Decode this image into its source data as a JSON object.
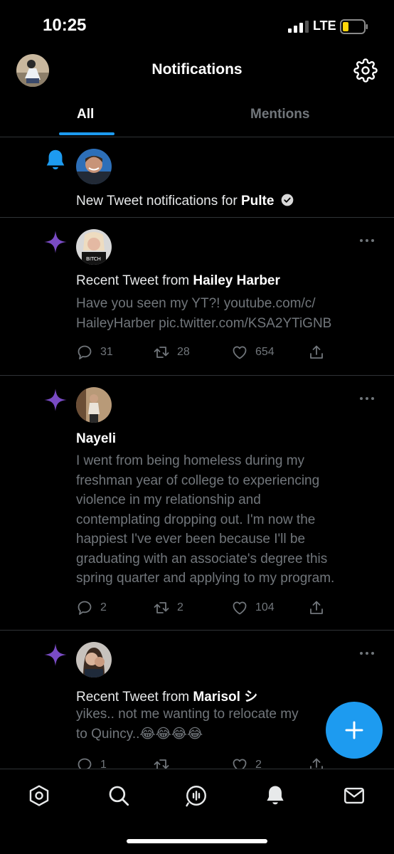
{
  "status_bar": {
    "time": "10:25",
    "network": "LTE"
  },
  "header": {
    "title": "Notifications"
  },
  "tabs": [
    {
      "label": "All"
    },
    {
      "label": "Mentions"
    }
  ],
  "notifications": [
    {
      "type": "new-tweet-notifications",
      "icon": "bell-icon",
      "text_prefix": "New Tweet notifications for ",
      "name": "Pulte",
      "verified": true
    },
    {
      "type": "recent-tweet",
      "icon": "sparkle-icon",
      "text_prefix": "Recent Tweet from ",
      "name": "Hailey Harber",
      "body_lines": [
        "Have you seen my YT?!  youtube.com/c/",
        "HaileyHarber pic.twitter.com/KSA2YTiGNB"
      ],
      "replies": "31",
      "retweets": "28",
      "likes": "654"
    },
    {
      "type": "recommended-tweet",
      "icon": "sparkle-icon",
      "name": "Nayeli",
      "body_lines": [
        "I went from being homeless during my",
        "freshman year of college to experiencing",
        "violence in my relationship and",
        "contemplating dropping out. I'm now the",
        "happiest I've ever been because I'll be",
        "graduating with an associate's degree this",
        "spring quarter and applying to my program."
      ],
      "replies": "2",
      "retweets": "2",
      "likes": "104"
    },
    {
      "type": "recent-tweet",
      "icon": "sparkle-icon",
      "text_prefix": "Recent Tweet from ",
      "name": "Marisol シ",
      "body_lines": [
        "yikes.. not me wanting to relocate my",
        "to Quincy..😂😂😂😂"
      ],
      "replies": "1",
      "retweets": "",
      "likes": "2"
    }
  ],
  "fab": {
    "icon": "compose-plus-icon"
  },
  "bottom_nav": [
    {
      "icon": "home-icon"
    },
    {
      "icon": "search-icon"
    },
    {
      "icon": "spaces-icon"
    },
    {
      "icon": "bell-icon",
      "active": true
    },
    {
      "icon": "mail-icon"
    }
  ],
  "colors": {
    "accent": "#1d9bf0",
    "sparkle": "#794bc4",
    "muted": "#71767b",
    "divider": "#2f3336"
  }
}
